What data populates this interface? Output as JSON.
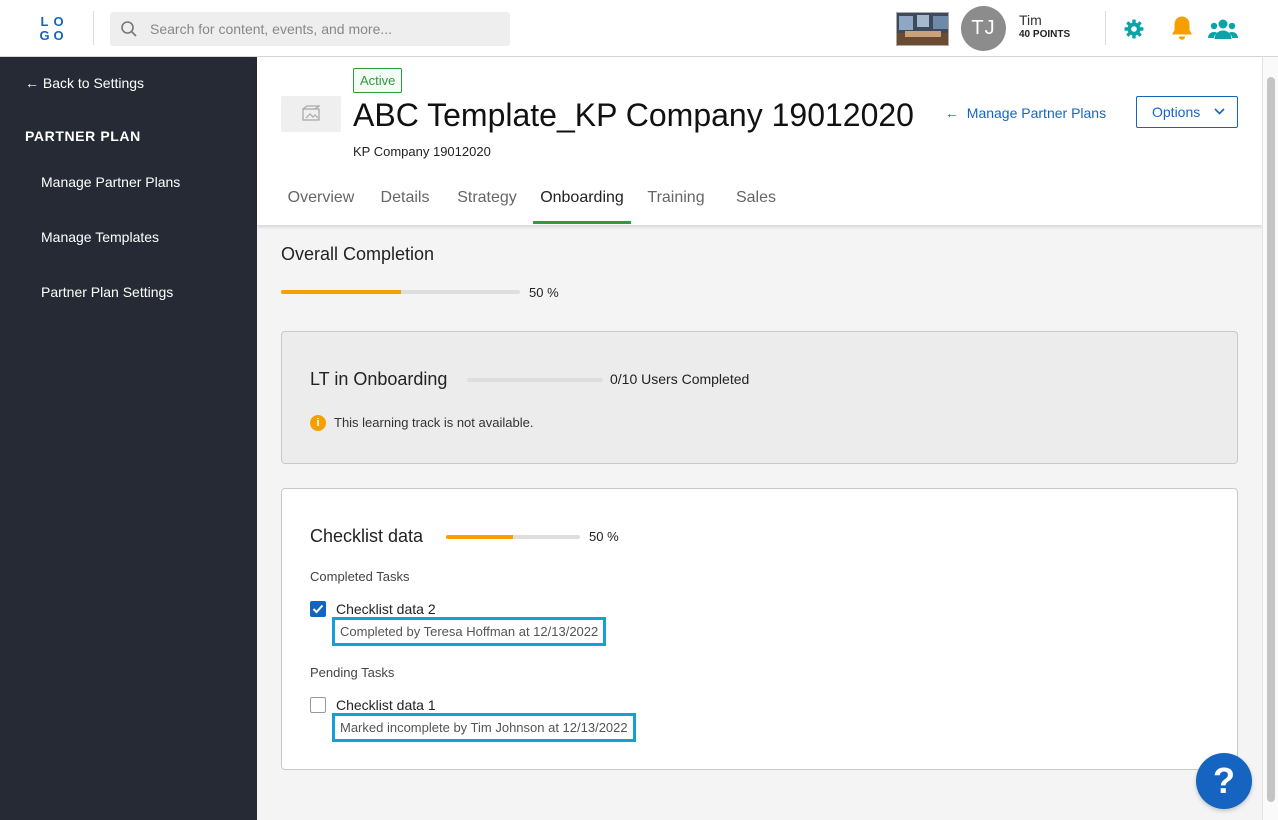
{
  "logo": {
    "letters": [
      "L",
      "O",
      "G",
      "O"
    ]
  },
  "search": {
    "placeholder": "Search for content, events, and more..."
  },
  "user": {
    "initials": "TJ",
    "name": "Tim",
    "points": "40 POINTS"
  },
  "sidebar": {
    "back_label": "Back to Settings",
    "heading": "PARTNER PLAN",
    "items": [
      {
        "label": "Manage Partner Plans"
      },
      {
        "label": "Manage Templates"
      },
      {
        "label": "Partner Plan Settings"
      }
    ]
  },
  "plan": {
    "status": "Active",
    "title": "ABC Template_KP Company 19012020",
    "company": "KP Company 19012020",
    "manage_link": "Manage Partner Plans",
    "options_label": "Options"
  },
  "tabs": [
    {
      "label": "Overview"
    },
    {
      "label": "Details"
    },
    {
      "label": "Strategy"
    },
    {
      "label": "Onboarding",
      "active": true
    },
    {
      "label": "Training"
    },
    {
      "label": "Sales"
    }
  ],
  "overall": {
    "title": "Overall Completion",
    "percent": 50,
    "percent_label": "50 %"
  },
  "learning_track": {
    "title": "LT in Onboarding",
    "progress": 0,
    "users_completed": "0/10 Users Completed",
    "notice": "This learning track is not available."
  },
  "checklist": {
    "title": "Checklist data",
    "percent": 50,
    "percent_label": "50 %",
    "completed_label": "Completed Tasks",
    "pending_label": "Pending Tasks",
    "completed": [
      {
        "name": "Checklist data 2",
        "meta": "Completed by Teresa Hoffman at 12/13/2022",
        "checked": true
      }
    ],
    "pending": [
      {
        "name": "Checklist data 1",
        "meta": "Marked incomplete by Tim Johnson at 12/13/2022",
        "checked": false
      }
    ]
  },
  "help_label": "?",
  "colors": {
    "accent": "#1565c0",
    "progress": "#f5a000",
    "active": "#2e9a41",
    "sidebar": "#252a34",
    "highlight": "#14a0d6"
  }
}
